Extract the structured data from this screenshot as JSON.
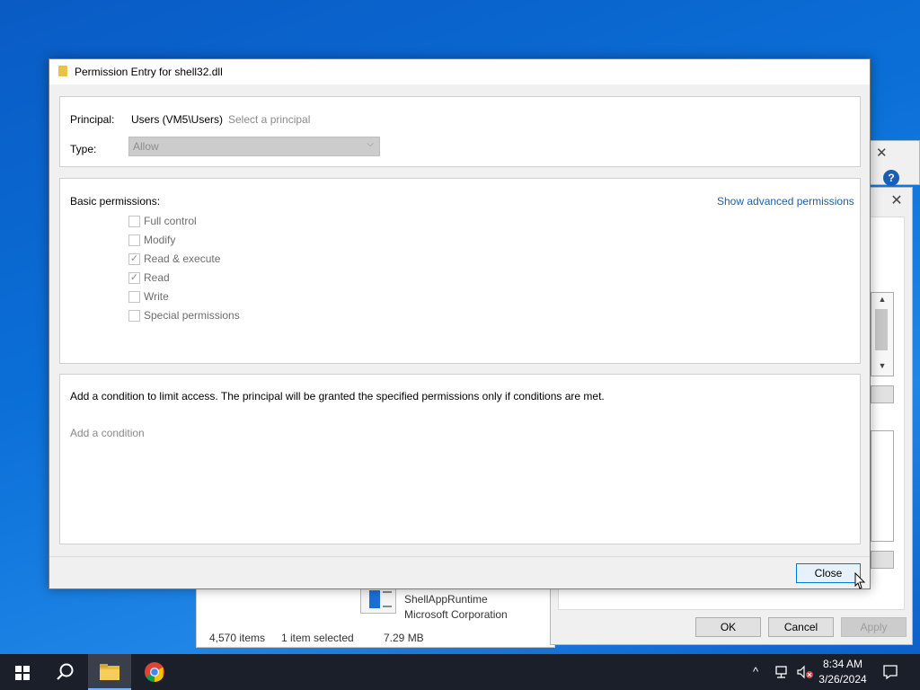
{
  "dialog": {
    "title": "Permission Entry for shell32.dll",
    "principal_label": "Principal:",
    "principal_value": "Users (VM5\\Users)",
    "select_principal_link": "Select a principal",
    "type_label": "Type:",
    "type_value": "Allow",
    "basic_permissions_label": "Basic permissions:",
    "show_advanced_link": "Show advanced permissions",
    "permissions": [
      {
        "label": "Full control",
        "checked": false
      },
      {
        "label": "Modify",
        "checked": false
      },
      {
        "label": "Read & execute",
        "checked": true
      },
      {
        "label": "Read",
        "checked": true
      },
      {
        "label": "Write",
        "checked": false
      },
      {
        "label": "Special permissions",
        "checked": false
      }
    ],
    "condition_text": "Add a condition to limit access. The principal will be granted the specified permissions only if conditions are met.",
    "add_condition_link": "Add a condition",
    "close_button": "Close"
  },
  "background_props": {
    "ok_button": "OK",
    "cancel_button": "Cancel",
    "apply_button": "Apply"
  },
  "explorer": {
    "file_name": "ShellAppRuntime",
    "file_company": "Microsoft Corporation",
    "items_count": "4,570 items",
    "selected_info": "1 item selected",
    "selected_size": "7.29 MB"
  },
  "taskbar": {
    "time": "8:34 AM",
    "date": "3/26/2024",
    "apps": [
      "start-icon",
      "search-icon",
      "file-explorer-icon",
      "chrome-icon"
    ]
  },
  "colors": {
    "desktop": "#0b6fd8",
    "link": "#1f5fa6",
    "taskbar": "#1b1f2a",
    "close_button_border": "#0078d7"
  }
}
